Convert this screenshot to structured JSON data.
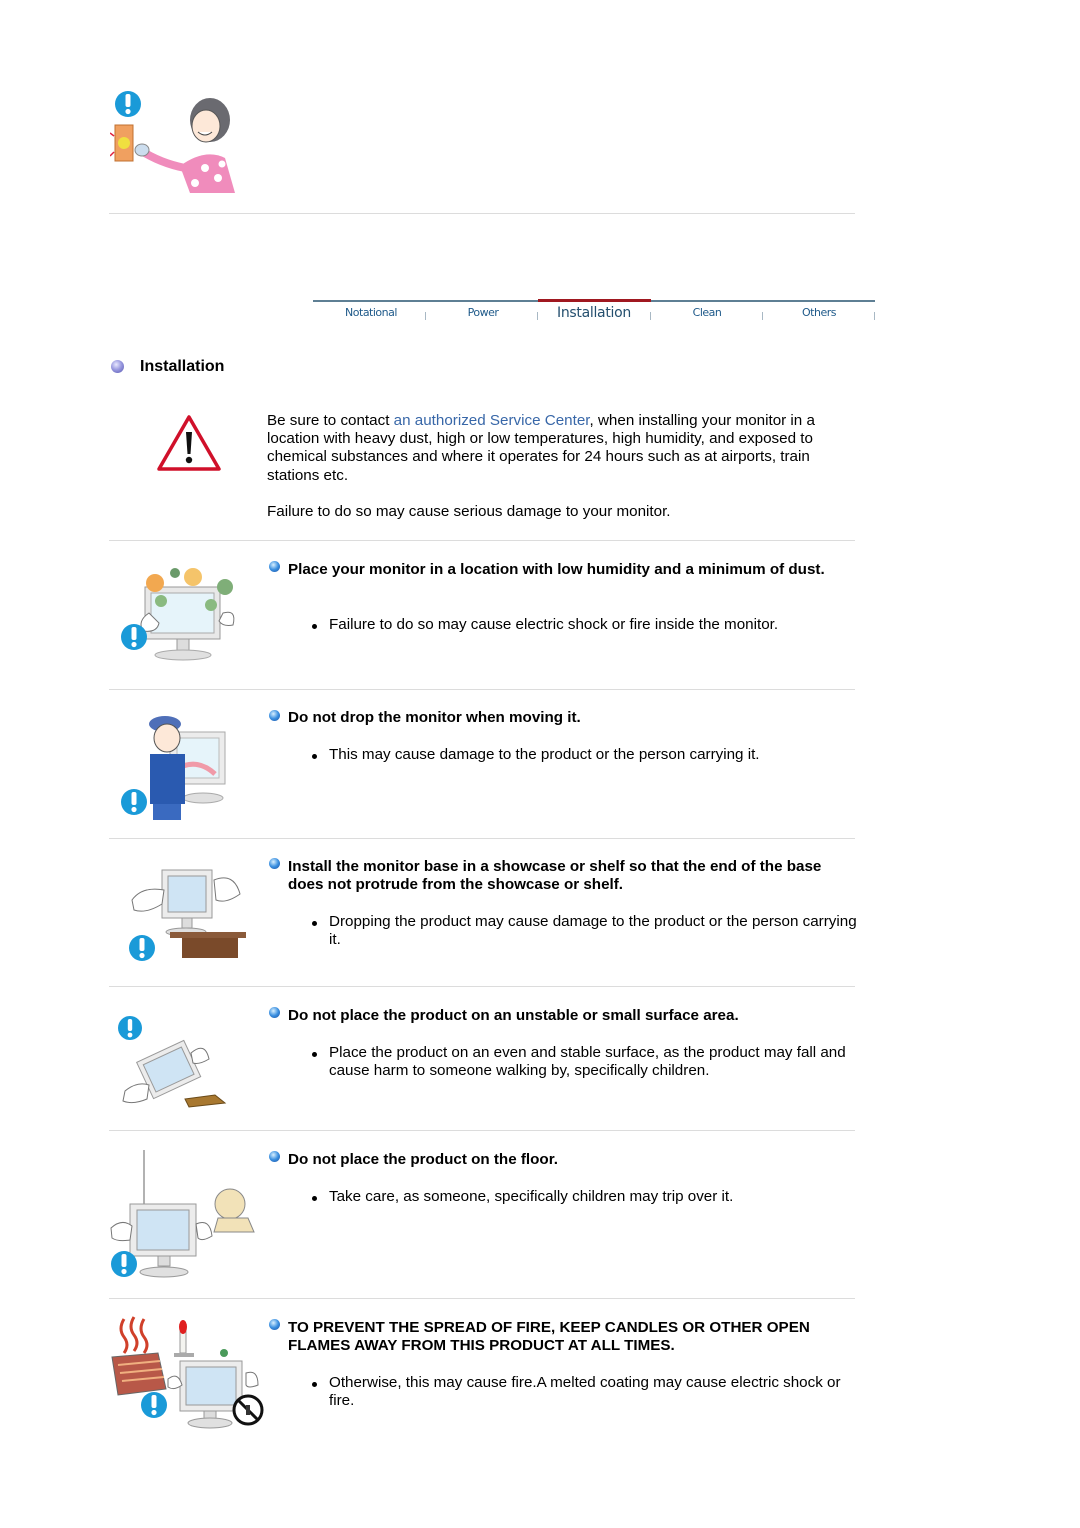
{
  "tabs": {
    "items": [
      {
        "label": "Notational",
        "active": false
      },
      {
        "label": "Power",
        "active": false
      },
      {
        "label": "Installation",
        "active": true
      },
      {
        "label": "Clean",
        "active": false
      },
      {
        "label": "Others",
        "active": false
      }
    ],
    "active_color": "#a01820",
    "line_color": "#5e7f94"
  },
  "section": {
    "title": "Installation",
    "intro": {
      "before_link": "Be sure to contact ",
      "link": "an authorized Service Center",
      "after_link": ", when installing your monitor in a location with heavy dust, high or low temperatures, high humidity, and exposed to chemical substances and where it operates for 24 hours such as at airports, train stations etc.",
      "note": "Failure to do so may cause serious damage to your monitor."
    }
  },
  "illustrations": {
    "top": "woman-unplugging-cord",
    "warning": "warning-triangle-icon"
  },
  "items": [
    {
      "title": "Place your monitor in a location with low humidity and a minimum of dust.",
      "bullet": "Failure to do so may cause electric shock or fire inside the monitor.",
      "illustration": "monitor-with-dust"
    },
    {
      "title": "Do not drop the monitor when moving it.",
      "bullet": "This may cause damage to the product or the person carrying it.",
      "illustration": "man-carrying-monitor"
    },
    {
      "title": "Install the monitor base in a showcase or shelf so that the end of the base does not protrude from the showcase or shelf.",
      "bullet": "Dropping the product may cause damage to the product or the person carrying it.",
      "illustration": "monitor-on-shelf"
    },
    {
      "title": "Do not place the product on an unstable or small surface area.",
      "bullet": "Place the product on an even and stable surface, as the product may fall and cause harm to someone walking by, specifically children.",
      "illustration": "monitor-falling"
    },
    {
      "title": "Do not place the product on the floor.",
      "bullet": "Take care, as someone, specifically children may trip over it.",
      "illustration": "monitor-on-floor-with-child"
    },
    {
      "title": "TO PREVENT THE SPREAD OF FIRE, KEEP CANDLES OR OTHER OPEN FLAMES AWAY FROM THIS PRODUCT AT ALL TIMES.",
      "bullet": "Otherwise, this may cause fire.A melted coating may cause electric shock or fire.",
      "illustration": "monitor-near-candle-heater"
    }
  ]
}
